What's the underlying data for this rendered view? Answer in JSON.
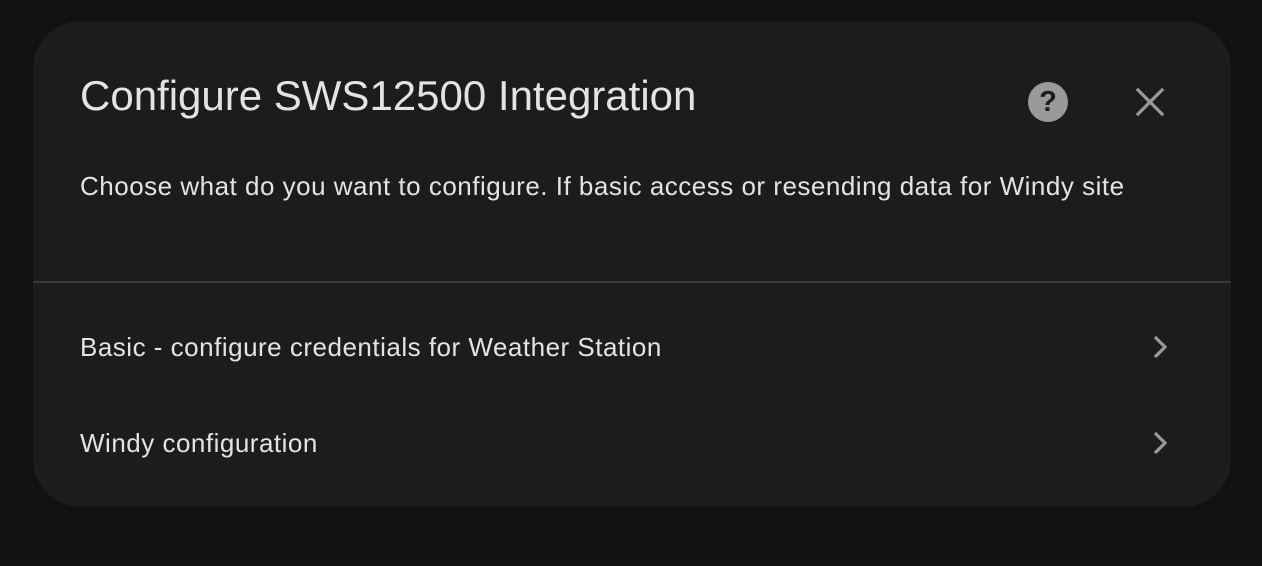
{
  "dialog": {
    "title": "Configure SWS12500 Integration",
    "description": "Choose what do you want to configure. If basic access or resending data for Windy site",
    "help_icon": "help-circle-icon",
    "help_glyph": "?",
    "close_icon": "close-icon",
    "menu_items": [
      {
        "label": "Basic - configure credentials for Weather Station",
        "icon": "chevron-right-icon"
      },
      {
        "label": "Windy configuration",
        "icon": "chevron-right-icon"
      }
    ]
  },
  "colors": {
    "background": "#111111",
    "dialog_background": "#1c1c1c",
    "text": "#e3e3e3",
    "icon": "#9a9a9a",
    "divider": "#3a3a3a"
  }
}
